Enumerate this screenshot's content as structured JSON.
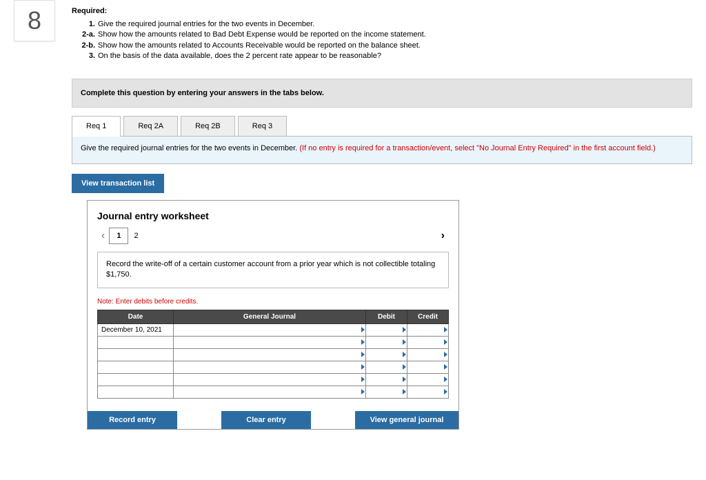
{
  "question_number": "8",
  "required_label": "Required:",
  "requirements": [
    {
      "num": "1.",
      "text": "Give the required journal entries for the two events in December."
    },
    {
      "num": "2-a.",
      "text": "Show how the amounts related to Bad Debt Expense would be reported on the income statement."
    },
    {
      "num": "2-b.",
      "text": "Show how the amounts related to Accounts Receivable would be reported on the balance sheet."
    },
    {
      "num": "3.",
      "text": "On the basis of the data available, does the 2 percent rate appear to be reasonable?"
    }
  ],
  "instruction_bar": "Complete this question by entering your answers in the tabs below.",
  "tabs": [
    "Req 1",
    "Req 2A",
    "Req 2B",
    "Req 3"
  ],
  "active_tab": 0,
  "panel_text": "Give the required journal entries for the two events in December. ",
  "panel_hint": "(If no entry is required for a transaction/event, select \"No Journal Entry Required\" in the first account field.)",
  "view_transaction_list": "View transaction list",
  "worksheet": {
    "title": "Journal entry worksheet",
    "pages": [
      "1",
      "2"
    ],
    "active_page": 0,
    "instruction": "Record the write-off of a certain customer account from a prior year which is not collectible totaling $1,750.",
    "note": "Note: Enter debits before credits.",
    "columns": {
      "date": "Date",
      "journal": "General Journal",
      "debit": "Debit",
      "credit": "Credit"
    },
    "rows": [
      {
        "date": "December 10, 2021",
        "journal": "",
        "debit": "",
        "credit": ""
      },
      {
        "date": "",
        "journal": "",
        "debit": "",
        "credit": ""
      },
      {
        "date": "",
        "journal": "",
        "debit": "",
        "credit": ""
      },
      {
        "date": "",
        "journal": "",
        "debit": "",
        "credit": ""
      },
      {
        "date": "",
        "journal": "",
        "debit": "",
        "credit": ""
      },
      {
        "date": "",
        "journal": "",
        "debit": "",
        "credit": ""
      }
    ],
    "buttons": {
      "record": "Record entry",
      "clear": "Clear entry",
      "view": "View general journal"
    }
  }
}
